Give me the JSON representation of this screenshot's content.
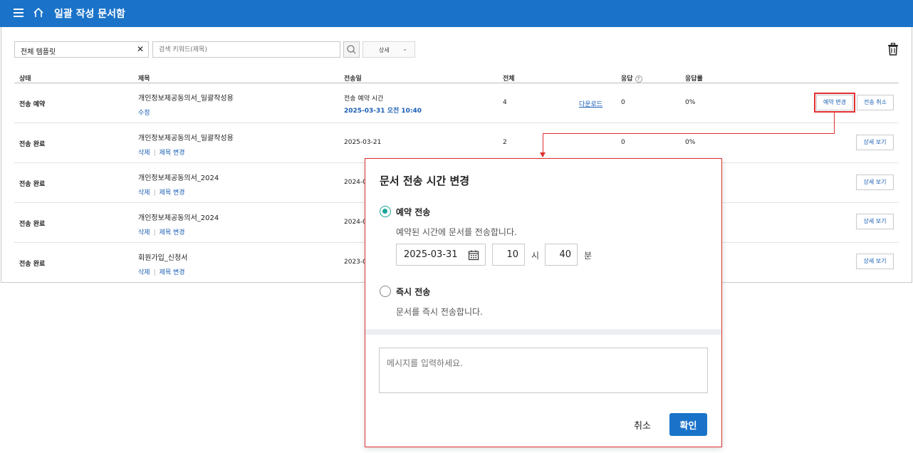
{
  "header": {
    "title": "일괄 작성 문서함"
  },
  "filters": {
    "template_value": "전체 템플릿",
    "template_clear": "✕",
    "keyword_placeholder": "검색 키워드(제목)",
    "detail_label": "상세",
    "detail_chevron": "⌄"
  },
  "table": {
    "headers": {
      "status": "상태",
      "title": "제목",
      "sent_date": "전송일",
      "total": "전체",
      "response": "응답",
      "response_help": "?",
      "response_rate": "응답률"
    },
    "rows": [
      {
        "status": "전송 예약",
        "title": "개인정보제공동의서_일괄작성용",
        "action_1": "수정",
        "action_2": "",
        "sent_label": "전송 예약 시간",
        "sent_date": "2025-03-31 오전 10:40",
        "total": "4",
        "download": "다운로드",
        "response": "0",
        "response_rate": "0%",
        "button_1": "예약 변경",
        "button_2": "전송 취소"
      },
      {
        "status": "전송 완료",
        "title": "개인정보제공동의서_일괄작성용",
        "action_1": "삭제",
        "action_2": "제목 변경",
        "sent_date": "2025-03-21",
        "total": "2",
        "response": "0",
        "response_rate": "0%",
        "button_1": "상세 보기"
      },
      {
        "status": "전송 완료",
        "title": "개인정보제공동의서_2024",
        "action_1": "삭제",
        "action_2": "제목 변경",
        "sent_date": "2024-0",
        "button_1": "상세 보기"
      },
      {
        "status": "전송 완료",
        "title": "개인정보제공동의서_2024",
        "action_1": "삭제",
        "action_2": "제목 변경",
        "sent_date": "2024-0",
        "button_1": "상세 보기"
      },
      {
        "status": "전송 완료",
        "title": "회원가입_신청서",
        "action_1": "삭제",
        "action_2": "제목 변경",
        "sent_date": "2023-0",
        "button_1": "상세 보기"
      }
    ]
  },
  "dialog": {
    "title": "문서 전송 시간 변경",
    "option_scheduled": {
      "label": "예약 전송",
      "description": "예약된 시간에 문서를 전송합니다.",
      "selected": true
    },
    "date": "2025-03-31",
    "hour": "10",
    "hour_unit": "시",
    "minute": "40",
    "minute_unit": "분",
    "option_immediate": {
      "label": "즉시 전송",
      "description": "문서를 즉시 전송합니다.",
      "selected": false
    },
    "message_placeholder": "메시지를 입력하세요.",
    "cancel_label": "취소",
    "confirm_label": "확인"
  },
  "colors": {
    "header_bg": "#1a73c9",
    "link_blue": "#1a5fb4",
    "highlight_red": "#e03030",
    "radio_teal": "#1aa39a"
  }
}
